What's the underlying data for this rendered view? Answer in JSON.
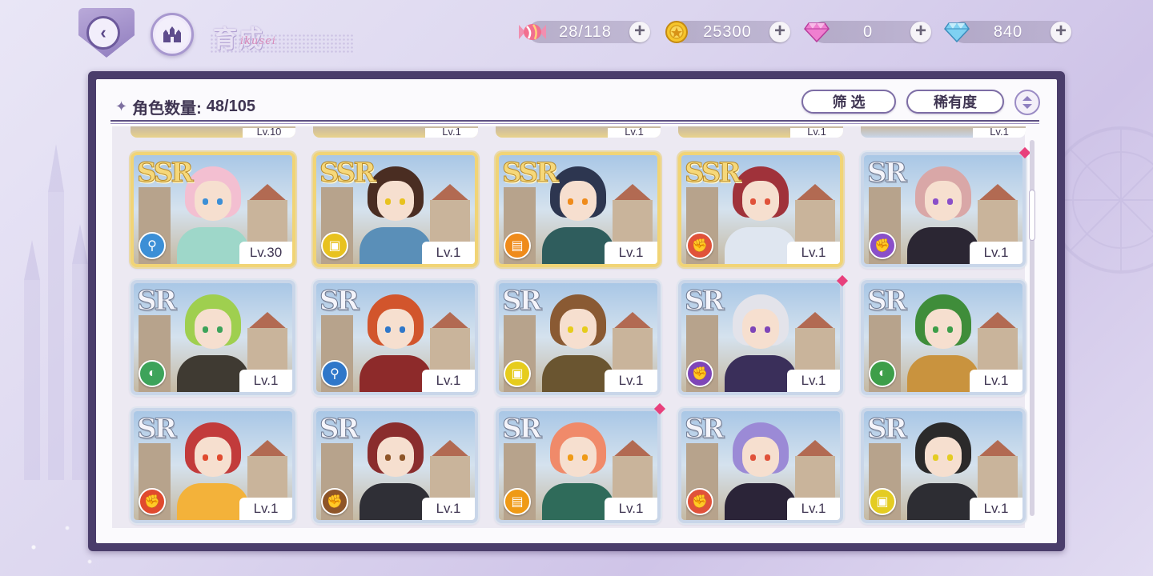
{
  "header": {
    "title": "育成",
    "title_script": "ikusei"
  },
  "currencies": [
    {
      "name": "candy",
      "value": "28/118",
      "icon": "candy-icon",
      "color": "#e36b8e"
    },
    {
      "name": "gold",
      "value": "25300",
      "icon": "gold-coin-icon",
      "color": "#f0b81c"
    },
    {
      "name": "pink-gem",
      "value": "0",
      "icon": "pink-diamond-icon",
      "color": "#e46bc9"
    },
    {
      "name": "blue-gem",
      "value": "840",
      "icon": "blue-diamond-icon",
      "color": "#6bc3ea"
    }
  ],
  "panel": {
    "count_label": "角色数量:",
    "count_value": "48/105",
    "filter_label": "筛 选",
    "sort_label": "稀有度"
  },
  "partial_row": [
    "Lv.10",
    "Lv.1",
    "Lv.1",
    "Lv.1",
    "Lv.1"
  ],
  "cards": [
    {
      "rarity": "SSR",
      "level": "Lv.30",
      "element": "blue",
      "element_color": "#3c8fd6",
      "hair": "#f3bfd1",
      "outfit": "#9ed7c9",
      "marked": false
    },
    {
      "rarity": "SSR",
      "level": "Lv.1",
      "element": "yellow",
      "element_color": "#e8c21f",
      "hair": "#4a2d22",
      "outfit": "#5a8fb8",
      "marked": false
    },
    {
      "rarity": "SSR",
      "level": "Lv.1",
      "element": "orange",
      "element_color": "#ef8b1b",
      "hair": "#2d3650",
      "outfit": "#2f5d5d",
      "marked": false
    },
    {
      "rarity": "SSR",
      "level": "Lv.1",
      "element": "red",
      "element_color": "#e0523a",
      "hair": "#a0323a",
      "outfit": "#dfe6f0",
      "marked": false
    },
    {
      "rarity": "SR",
      "level": "Lv.1",
      "element": "purple",
      "element_color": "#8a4fc9",
      "hair": "#d9a7a7",
      "outfit": "#2b2633",
      "marked": true
    },
    {
      "rarity": "SR",
      "level": "Lv.1",
      "element": "green",
      "element_color": "#3da35a",
      "hair": "#9fcf4f",
      "outfit": "#3f3a32",
      "marked": false
    },
    {
      "rarity": "SR",
      "level": "Lv.1",
      "element": "blue",
      "element_color": "#2f77c9",
      "hair": "#d2552c",
      "outfit": "#8d2a2a",
      "marked": false
    },
    {
      "rarity": "SR",
      "level": "Lv.1",
      "element": "yellow",
      "element_color": "#e6cc1c",
      "hair": "#8a5a33",
      "outfit": "#6a5530",
      "marked": false
    },
    {
      "rarity": "SR",
      "level": "Lv.1",
      "element": "purple",
      "element_color": "#7e45b8",
      "hair": "#e3e3ea",
      "outfit": "#3a2f5a",
      "marked": true
    },
    {
      "rarity": "SR",
      "level": "Lv.1",
      "element": "green",
      "element_color": "#3d9e49",
      "hair": "#3f8d3a",
      "outfit": "#c9933e",
      "marked": false
    },
    {
      "rarity": "SR",
      "level": "Lv.1",
      "element": "red",
      "element_color": "#e04a2e",
      "hair": "#c23b3b",
      "outfit": "#f3b23a",
      "marked": false
    },
    {
      "rarity": "SR",
      "level": "Lv.1",
      "element": "brown",
      "element_color": "#8e5528",
      "hair": "#8a2d2d",
      "outfit": "#2f2f36",
      "marked": false
    },
    {
      "rarity": "SR",
      "level": "Lv.1",
      "element": "orange",
      "element_color": "#ef9a16",
      "hair": "#f08a6a",
      "outfit": "#2f6b5a",
      "marked": true
    },
    {
      "rarity": "SR",
      "level": "Lv.1",
      "element": "red",
      "element_color": "#e0523a",
      "hair": "#9b8ad6",
      "outfit": "#2b2438",
      "marked": false
    },
    {
      "rarity": "SR",
      "level": "Lv.1",
      "element": "yellow",
      "element_color": "#e4cc22",
      "hair": "#2b2a2a",
      "outfit": "#2d2d33",
      "marked": false
    }
  ]
}
